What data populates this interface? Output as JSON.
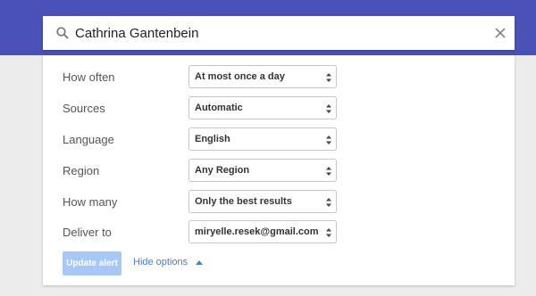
{
  "search": {
    "value": "Cathrina Gantenbein",
    "search_icon": "search-icon",
    "clear_icon": "close-icon"
  },
  "options": [
    {
      "id": "how-often",
      "label": "How often",
      "value": "At most once a day"
    },
    {
      "id": "sources",
      "label": "Sources",
      "value": "Automatic"
    },
    {
      "id": "language",
      "label": "Language",
      "value": "English"
    },
    {
      "id": "region",
      "label": "Region",
      "value": "Any Region"
    },
    {
      "id": "how-many",
      "label": "How many",
      "value": "Only the best results"
    },
    {
      "id": "deliver-to",
      "label": "Deliver to",
      "value": "miryelle.resek@gmail.com"
    }
  ],
  "actions": {
    "update_label": "Update alert",
    "hide_options_label": "Hide options"
  },
  "colors": {
    "header": "#4a51b6",
    "update_button": "#a9c7f5",
    "link": "#4a7ad9"
  }
}
